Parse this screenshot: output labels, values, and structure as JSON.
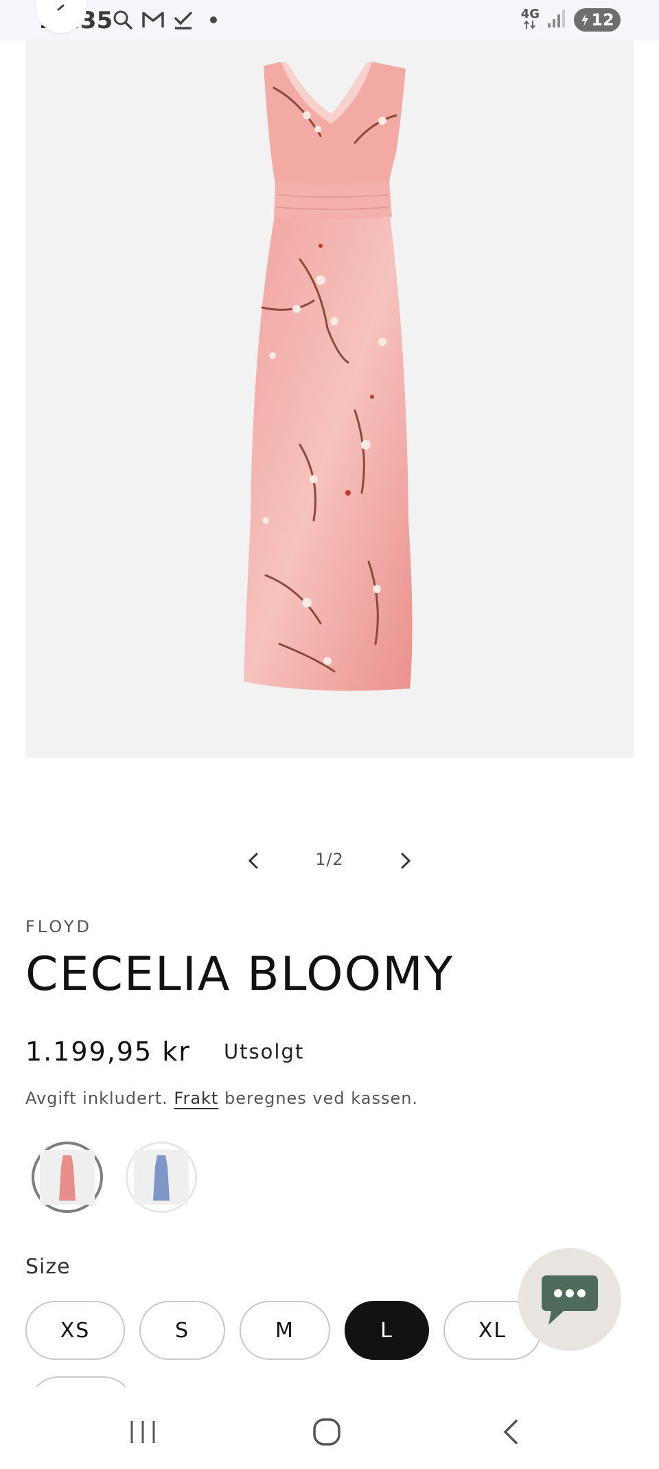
{
  "status_bar": {
    "time": "16:35",
    "icons": [
      "search-icon",
      "gmail-icon",
      "task-check-icon",
      "dot-icon"
    ],
    "network": "4G",
    "battery": "12"
  },
  "product": {
    "vendor": "FLOYD",
    "title": "CECELIA BLOOMY",
    "price": "1.199,95 kr",
    "availability": "Utsolgt",
    "tax_prefix": "Avgift inkludert.",
    "tax_link": "Frakt",
    "tax_suffix": "beregnes ved kassen.",
    "image_counter": "1/2"
  },
  "variants": {
    "swatches": [
      {
        "name": "pink",
        "color": "#e88f8c",
        "selected": true
      },
      {
        "name": "blue",
        "color": "#7f97c7",
        "selected": false
      }
    ]
  },
  "sizes": {
    "label": "Size",
    "options": [
      "XS",
      "S",
      "M",
      "L",
      "XL"
    ],
    "selected": "L"
  },
  "colors": {
    "dress_pink": "#f0a4a0",
    "accent_green": "#4e6b5b",
    "selected_dark": "#121212"
  }
}
